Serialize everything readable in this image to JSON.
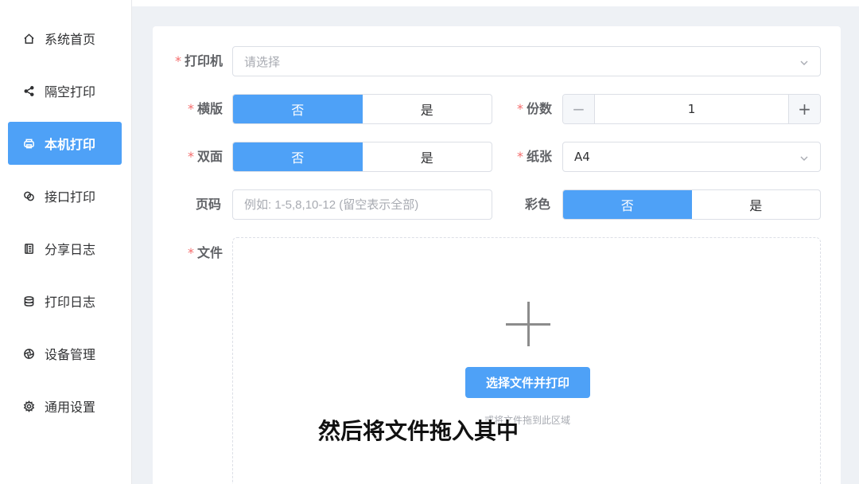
{
  "sidebar": {
    "items": [
      {
        "label": "系统首页",
        "icon": "home-icon"
      },
      {
        "label": "隔空打印",
        "icon": "share-icon"
      },
      {
        "label": "本机打印",
        "icon": "printer-icon",
        "active": true
      },
      {
        "label": "接口打印",
        "icon": "link-icon"
      },
      {
        "label": "分享日志",
        "icon": "document-icon"
      },
      {
        "label": "打印日志",
        "icon": "database-icon"
      },
      {
        "label": "设备管理",
        "icon": "aperture-icon"
      },
      {
        "label": "通用设置",
        "icon": "gear-icon"
      }
    ]
  },
  "form": {
    "printer": {
      "label": "打印机",
      "placeholder": "请选择"
    },
    "landscape": {
      "label": "横版",
      "options": [
        "否",
        "是"
      ],
      "selected": "否"
    },
    "copies": {
      "label": "份数",
      "value": "1",
      "dec": "−",
      "inc": "+"
    },
    "duplex": {
      "label": "双面",
      "options": [
        "否",
        "是"
      ],
      "selected": "否"
    },
    "paper": {
      "label": "纸张",
      "value": "A4"
    },
    "pages": {
      "label": "页码",
      "placeholder": "例如: 1-5,8,10-12 (留空表示全部)"
    },
    "color": {
      "label": "彩色",
      "options": [
        "否",
        "是"
      ],
      "selected": "否"
    },
    "file": {
      "label": "文件",
      "button": "选择文件并打印",
      "hint": "或将文件拖到此区域"
    }
  },
  "subtitle": "然后将文件拖入其中",
  "colors": {
    "accent": "#4ea1f7",
    "required": "#f56c6c"
  }
}
